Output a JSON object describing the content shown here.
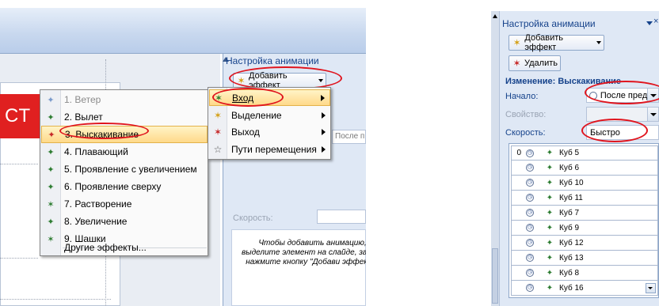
{
  "left": {
    "slide_text": "СТ",
    "pane": {
      "title": "Настройка анимации",
      "add_effect": "Добавить эффект",
      "start_value": "После п",
      "speed_label": "Скорость:",
      "hint": "Чтобы добавить анимацию, выделите элемент на слайде, затем нажмите кнопку \"Добави эффект\"."
    },
    "main_menu": [
      {
        "label": "Вход",
        "icon": "entrance-star-icon"
      },
      {
        "label": "Выделение",
        "icon": "emphasis-star-icon"
      },
      {
        "label": "Выход",
        "icon": "exit-star-icon"
      },
      {
        "label": "Пути перемещения",
        "icon": "motion-path-star-icon"
      }
    ],
    "submenu": [
      {
        "label": "1. Ветер",
        "key": "1"
      },
      {
        "label": "2. Вылет",
        "key": "2"
      },
      {
        "label": "3. Выскакивание",
        "key": "3"
      },
      {
        "label": "4. Плавающий",
        "key": "4"
      },
      {
        "label": "5. Проявление с увеличением",
        "key": "5"
      },
      {
        "label": "6. Проявление сверху",
        "key": "6"
      },
      {
        "label": "7. Растворение",
        "key": "7"
      },
      {
        "label": "8. Увеличение",
        "key": "8"
      },
      {
        "label": "9. Шашки",
        "key": "9"
      }
    ],
    "more_effects": "Другие эффекты..."
  },
  "right": {
    "title": "Настройка анимации",
    "close": "×",
    "add_effect": "Добавить эффект",
    "remove": "Удалить",
    "heading": "Изменение: Выскакивание",
    "start_label": "Начало:",
    "start_value": "После пред",
    "property_label": "Свойство:",
    "speed_label": "Скорость:",
    "speed_value": "Быстро",
    "items": [
      {
        "order": "0",
        "name": "Куб 5"
      },
      {
        "order": "",
        "name": "Куб 6"
      },
      {
        "order": "",
        "name": "Куб 10"
      },
      {
        "order": "",
        "name": "Куб 11"
      },
      {
        "order": "",
        "name": "Куб 7"
      },
      {
        "order": "",
        "name": "Куб 9"
      },
      {
        "order": "",
        "name": "Куб 12"
      },
      {
        "order": "",
        "name": "Куб 13"
      },
      {
        "order": "",
        "name": "Куб 8"
      },
      {
        "order": "",
        "name": "Куб 16"
      }
    ]
  }
}
